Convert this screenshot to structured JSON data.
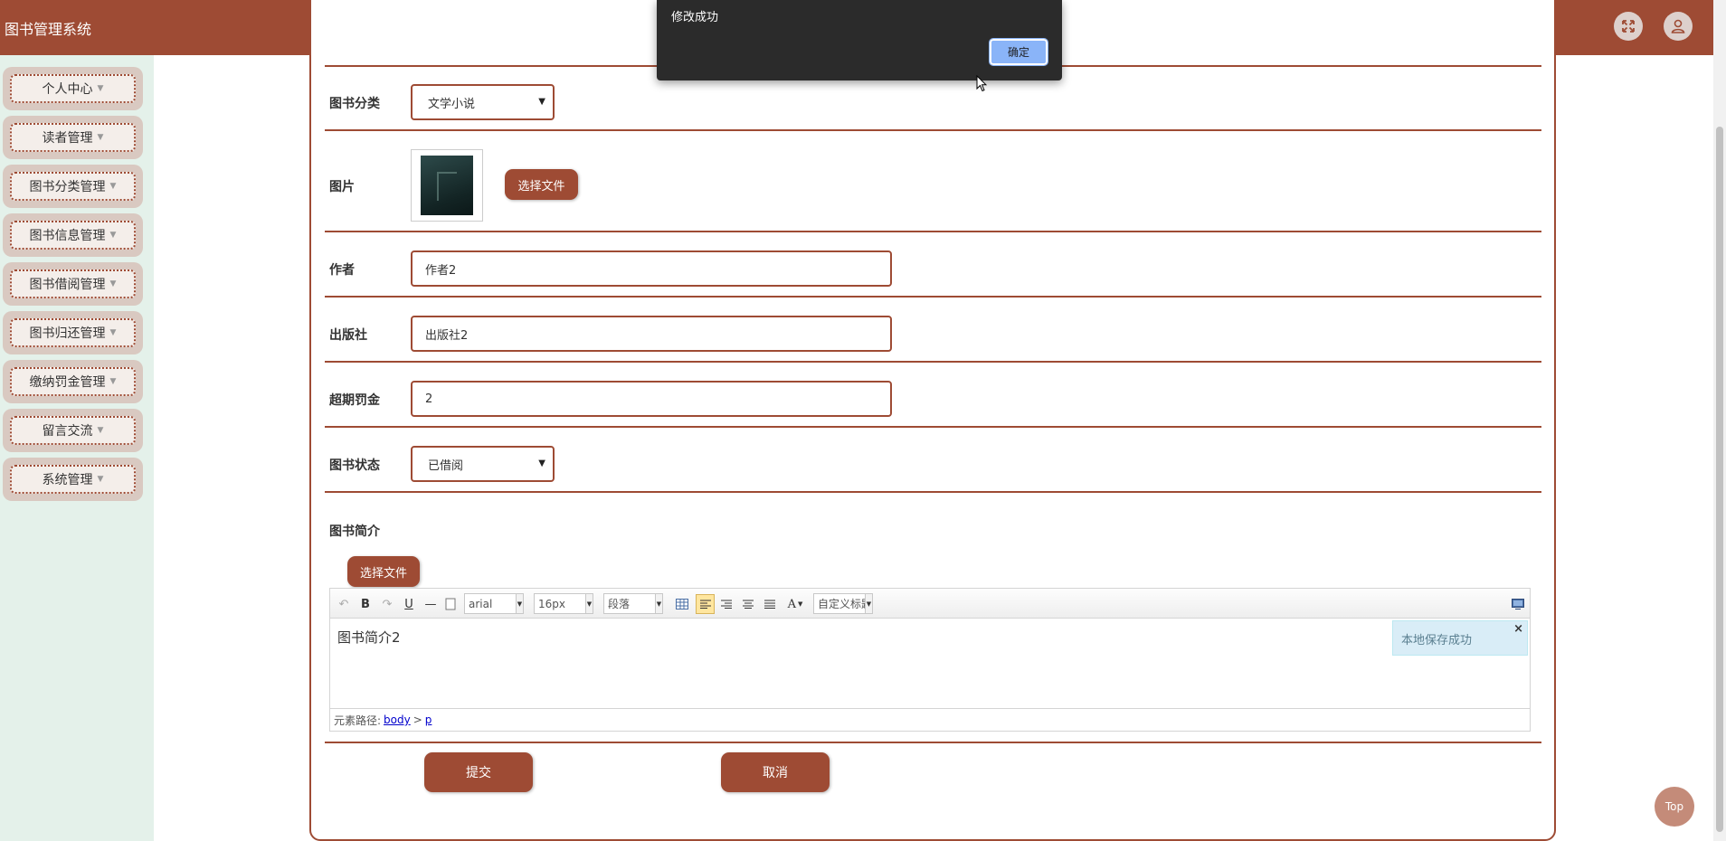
{
  "app": {
    "title": "图书管理系统"
  },
  "header": {
    "fullscreen_icon": "fullscreen-icon",
    "user_icon": "user-avatar-icon"
  },
  "sidebar": {
    "items": [
      {
        "label": "个人中心"
      },
      {
        "label": "读者管理"
      },
      {
        "label": "图书分类管理"
      },
      {
        "label": "图书信息管理"
      },
      {
        "label": "图书借阅管理"
      },
      {
        "label": "图书归还管理"
      },
      {
        "label": "缴纳罚金管理"
      },
      {
        "label": "留言交流"
      },
      {
        "label": "系统管理"
      }
    ]
  },
  "form": {
    "category": {
      "label": "图书分类",
      "value": "文学小说"
    },
    "image": {
      "label": "图片",
      "button": "选择文件"
    },
    "author": {
      "label": "作者",
      "value": "作者2"
    },
    "publisher": {
      "label": "出版社",
      "value": "出版社2"
    },
    "fine": {
      "label": "超期罚金",
      "value": "2"
    },
    "status": {
      "label": "图书状态",
      "value": "已借阅"
    },
    "intro": {
      "label": "图书简介",
      "upload_button": "选择文件",
      "content": "图书简介2",
      "toolbar": {
        "font_family": "arial",
        "font_size": "16px",
        "paragraph": "段落",
        "custom_title": "自定义标题"
      },
      "path_label": "元素路径:",
      "path_body": "body",
      "path_sep": ">",
      "path_p": "p",
      "toast": "本地保存成功"
    },
    "submit": "提交",
    "cancel": "取消"
  },
  "dialog": {
    "message": "修改成功",
    "ok": "确定"
  },
  "back_to_top": "Top",
  "colors": {
    "brand": "#9e4b34",
    "sidebar_bg": "#e4f1ea",
    "dialog_bg": "#2b2b2b",
    "dialog_button": "#8ab4f8"
  }
}
